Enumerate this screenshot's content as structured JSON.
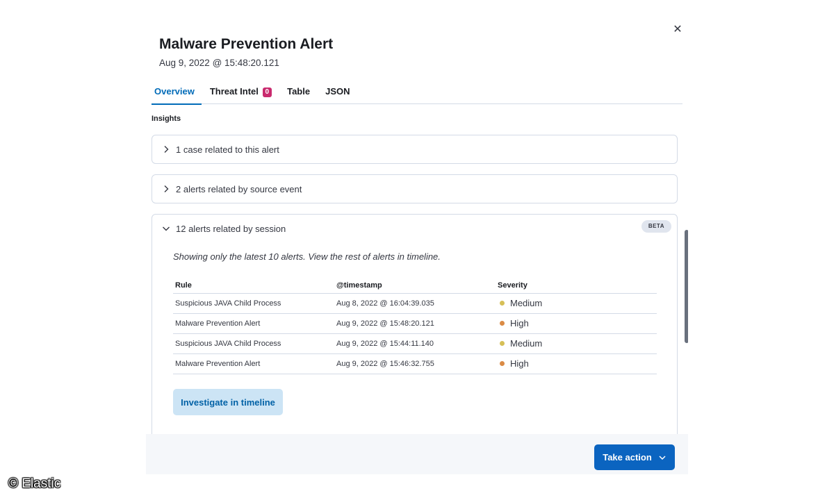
{
  "flyout": {
    "close_icon": "close-icon",
    "title": "Malware Prevention Alert",
    "subtitle": "Aug 9, 2022 @ 15:48:20.121"
  },
  "tabs": [
    {
      "label": "Overview",
      "active": true
    },
    {
      "label": "Threat Intel",
      "badge": "0"
    },
    {
      "label": "Table"
    },
    {
      "label": "JSON"
    }
  ],
  "insights": {
    "heading": "Insights",
    "cases_panel": {
      "label": "1 case related to this alert",
      "expanded": false
    },
    "source_panel": {
      "label": "2 alerts related by source event",
      "expanded": false
    },
    "session_panel": {
      "label": "12 alerts related by session",
      "expanded": true,
      "badge": "BETA",
      "note": "Showing only the latest 10 alerts. View the rest of alerts in timeline.",
      "columns": [
        "Rule",
        "@timestamp",
        "Severity"
      ],
      "rows": [
        {
          "rule": "Suspicious JAVA Child Process",
          "timestamp": "Aug 8, 2022 @ 16:04:39.035",
          "severity": "Medium"
        },
        {
          "rule": "Malware Prevention Alert",
          "timestamp": "Aug 9, 2022 @ 15:48:20.121",
          "severity": "High"
        },
        {
          "rule": "Suspicious JAVA Child Process",
          "timestamp": "Aug 9, 2022 @ 15:44:11.140",
          "severity": "Medium"
        },
        {
          "rule": "Malware Prevention Alert",
          "timestamp": "Aug 9, 2022 @ 15:46:32.755",
          "severity": "High"
        }
      ],
      "investigate_label": "Investigate in timeline"
    }
  },
  "footer": {
    "take_action_label": "Take action"
  },
  "severity_colors": {
    "Medium": "#d6bf57",
    "High": "#da8b45"
  },
  "accent_color": "#006bb8",
  "watermark": "© Elastic"
}
